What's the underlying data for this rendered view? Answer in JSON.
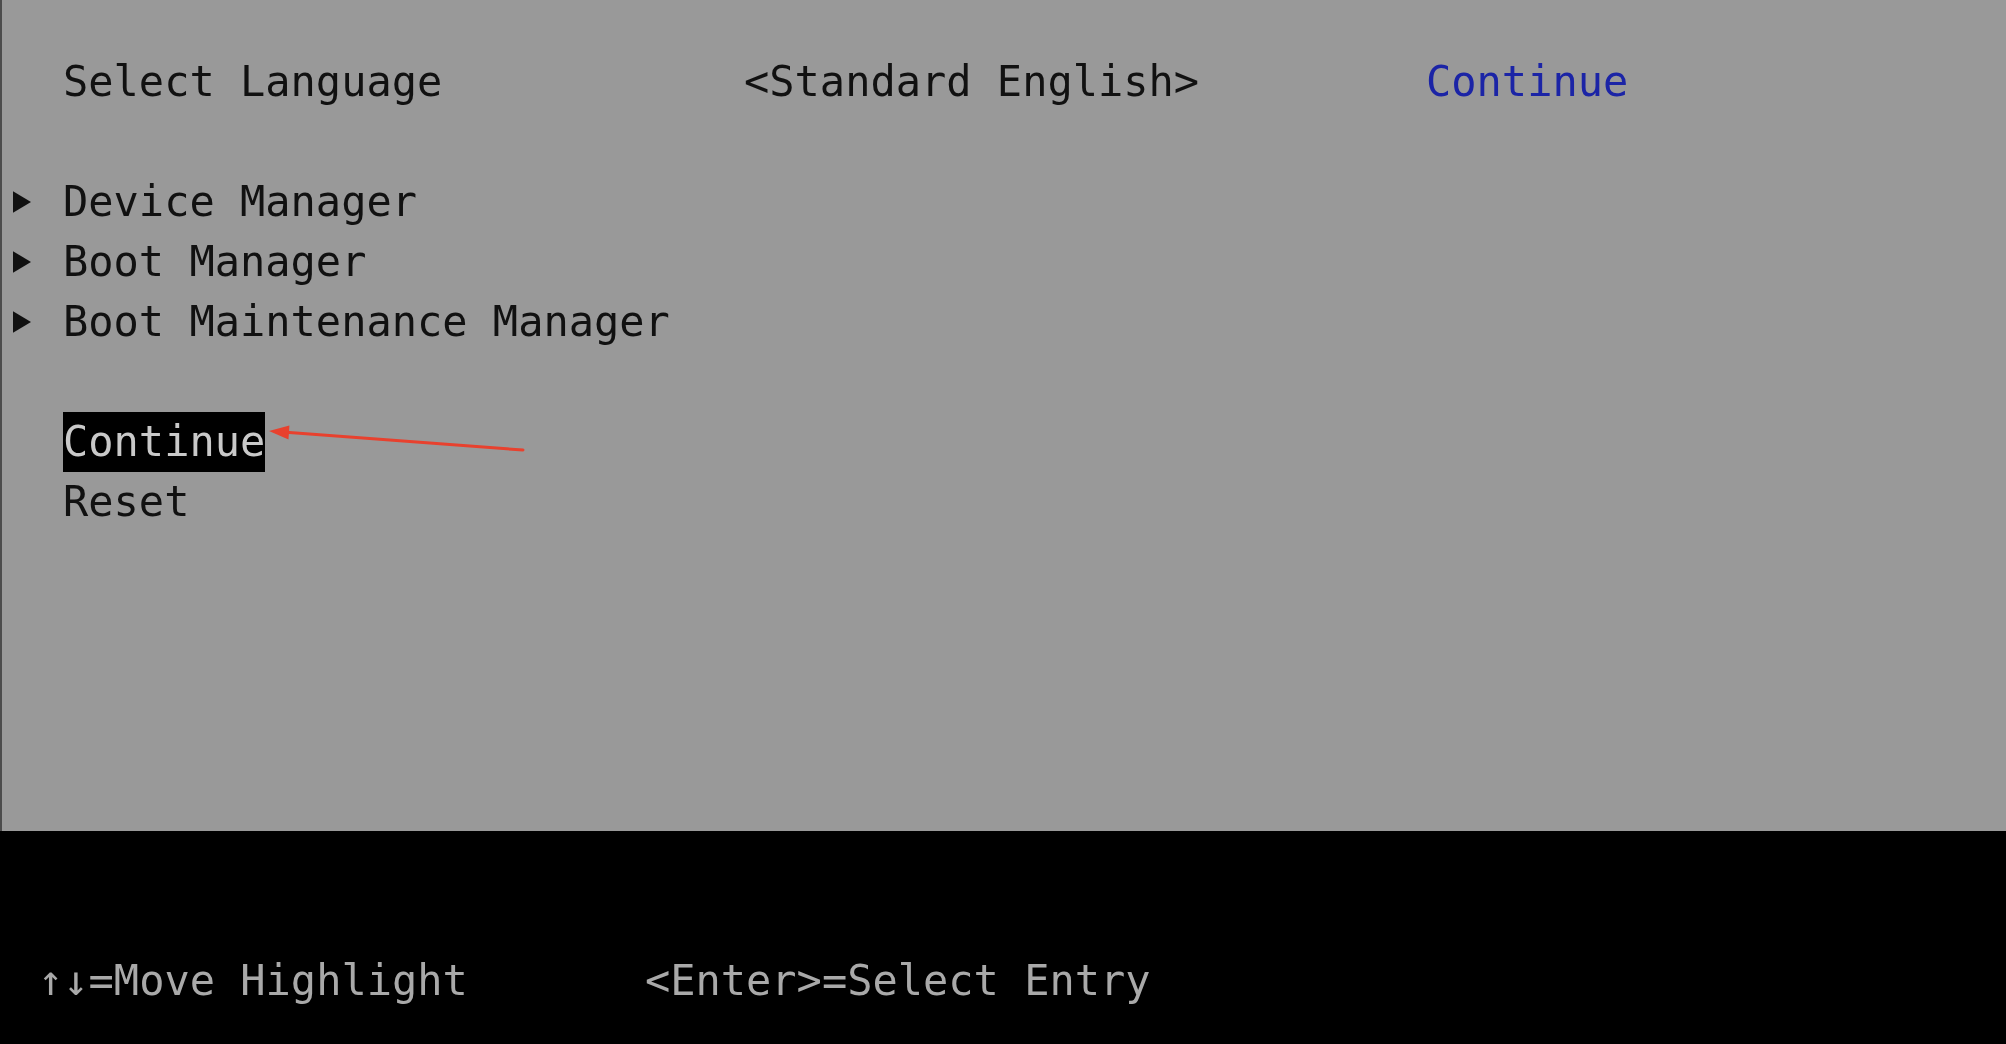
{
  "language_row": {
    "label": "Select Language",
    "value": "<Standard English>",
    "help_text": "Continue"
  },
  "submenus": [
    {
      "label": "Device Manager",
      "selected": false
    },
    {
      "label": "Boot Manager",
      "selected": false
    },
    {
      "label": "Boot Maintenance Manager",
      "selected": false
    }
  ],
  "actions": [
    {
      "label": "Continue",
      "selected": true
    },
    {
      "label": "Reset",
      "selected": false
    }
  ],
  "footer": {
    "hints": [
      "↑↓=Move Highlight",
      "<Enter>=Select Entry"
    ]
  }
}
